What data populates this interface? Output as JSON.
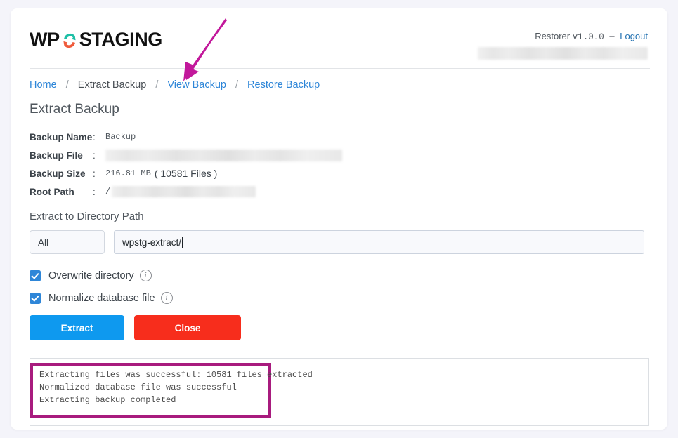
{
  "app": {
    "logo_text_left": "WP",
    "logo_text_right": "STAGING",
    "logo_mark_icon": "circular-refresh-arrows-icon",
    "restorer_label": "Restorer",
    "version": "v1.0.0",
    "dash": "–",
    "logout_label": "Logout",
    "account_redacted": ""
  },
  "breadcrumb": {
    "separator": "/",
    "items": [
      {
        "label": "Home",
        "current": false
      },
      {
        "label": "Extract Backup",
        "current": true
      },
      {
        "label": "View Backup",
        "current": false
      },
      {
        "label": "Restore Backup",
        "current": false
      }
    ]
  },
  "page": {
    "title": "Extract Backup"
  },
  "backup_info": {
    "colon": ":",
    "rows": [
      {
        "label": "Backup Name",
        "value": "Backup",
        "redacted": false
      },
      {
        "label": "Backup File",
        "value": "",
        "redacted": true
      },
      {
        "label": "Backup Size",
        "value": "216.81 MB",
        "suffix": "( 10581 Files )",
        "redacted": false
      },
      {
        "label": "Root Path",
        "value": "/",
        "redacted": true
      }
    ],
    "size_bytes_label": "216.81 MB",
    "file_count_label": "( 10581 Files )",
    "file_count": 10581
  },
  "form": {
    "directory_label": "Extract to Directory Path",
    "scope_select": {
      "selected": "All",
      "options": [
        "All"
      ]
    },
    "path_input": {
      "value": "wpstg-extract/",
      "placeholder": "wpstg-extract/"
    },
    "checkboxes": [
      {
        "label": "Overwrite directory",
        "checked": true,
        "info_icon": "info-circle-icon"
      },
      {
        "label": "Normalize database file",
        "checked": true,
        "info_icon": "info-circle-icon"
      }
    ]
  },
  "actions": {
    "extract_label": "Extract",
    "close_label": "Close"
  },
  "log": {
    "lines": [
      "Extracting files was successful: 10581 files extracted",
      "Normalized database file was successful",
      "Extracting backup completed"
    ],
    "text": "Extracting files was successful: 10581 files extracted\nNormalized database file was successful\nExtracting backup completed"
  },
  "annotations": {
    "arrow": {
      "icon": "annotation-arrow-icon",
      "points_to": "View Backup",
      "color": "#c2189b"
    },
    "highlight": {
      "icon": "annotation-rectangle-icon",
      "surrounds": "log output",
      "color": "#a81b7e"
    }
  },
  "colors": {
    "accent_blue": "#2e86d8",
    "extract_blue": "#0e99ef",
    "close_red": "#f72d1c",
    "annotation_magenta": "#c2189b",
    "highlight_purple": "#a81b7e",
    "page_bg": "#f4f4fa"
  }
}
